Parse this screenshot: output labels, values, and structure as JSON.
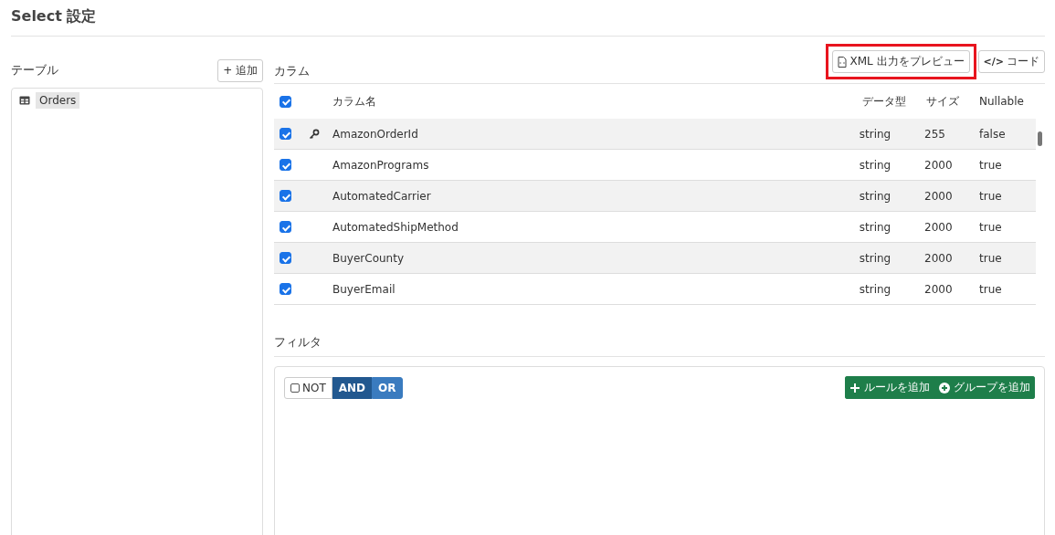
{
  "title": "Select 設定",
  "tables_panel": {
    "label": "テーブル",
    "add_button": "+ 追加",
    "items": [
      {
        "name": "Orders",
        "selected": true
      }
    ]
  },
  "columns_panel": {
    "label": "カラム",
    "preview_button": {
      "label": "XML 出力をプレビュー",
      "highlighted": true
    },
    "code_button": {
      "icon": "</>",
      "label": "コード"
    },
    "header": {
      "checked": true,
      "columns": [
        "カラム名",
        "データ型",
        "サイズ",
        "Nullable"
      ]
    },
    "rows": [
      {
        "checked": true,
        "key": true,
        "name": "AmazonOrderId",
        "type": "string",
        "size": "255",
        "nullable": "false"
      },
      {
        "checked": true,
        "key": false,
        "name": "AmazonPrograms",
        "type": "string",
        "size": "2000",
        "nullable": "true"
      },
      {
        "checked": true,
        "key": false,
        "name": "AutomatedCarrier",
        "type": "string",
        "size": "2000",
        "nullable": "true"
      },
      {
        "checked": true,
        "key": false,
        "name": "AutomatedShipMethod",
        "type": "string",
        "size": "2000",
        "nullable": "true"
      },
      {
        "checked": true,
        "key": false,
        "name": "BuyerCounty",
        "type": "string",
        "size": "2000",
        "nullable": "true"
      },
      {
        "checked": true,
        "key": false,
        "name": "BuyerEmail",
        "type": "string",
        "size": "2000",
        "nullable": "true"
      }
    ]
  },
  "filter_panel": {
    "label": "フィルタ",
    "not": {
      "label": "NOT",
      "checked": false
    },
    "combinators": [
      {
        "label": "AND",
        "selected": true
      },
      {
        "label": "OR",
        "selected": false
      }
    ],
    "add_rule_button": "ルールを追加",
    "add_group_button": "グループを追加"
  }
}
